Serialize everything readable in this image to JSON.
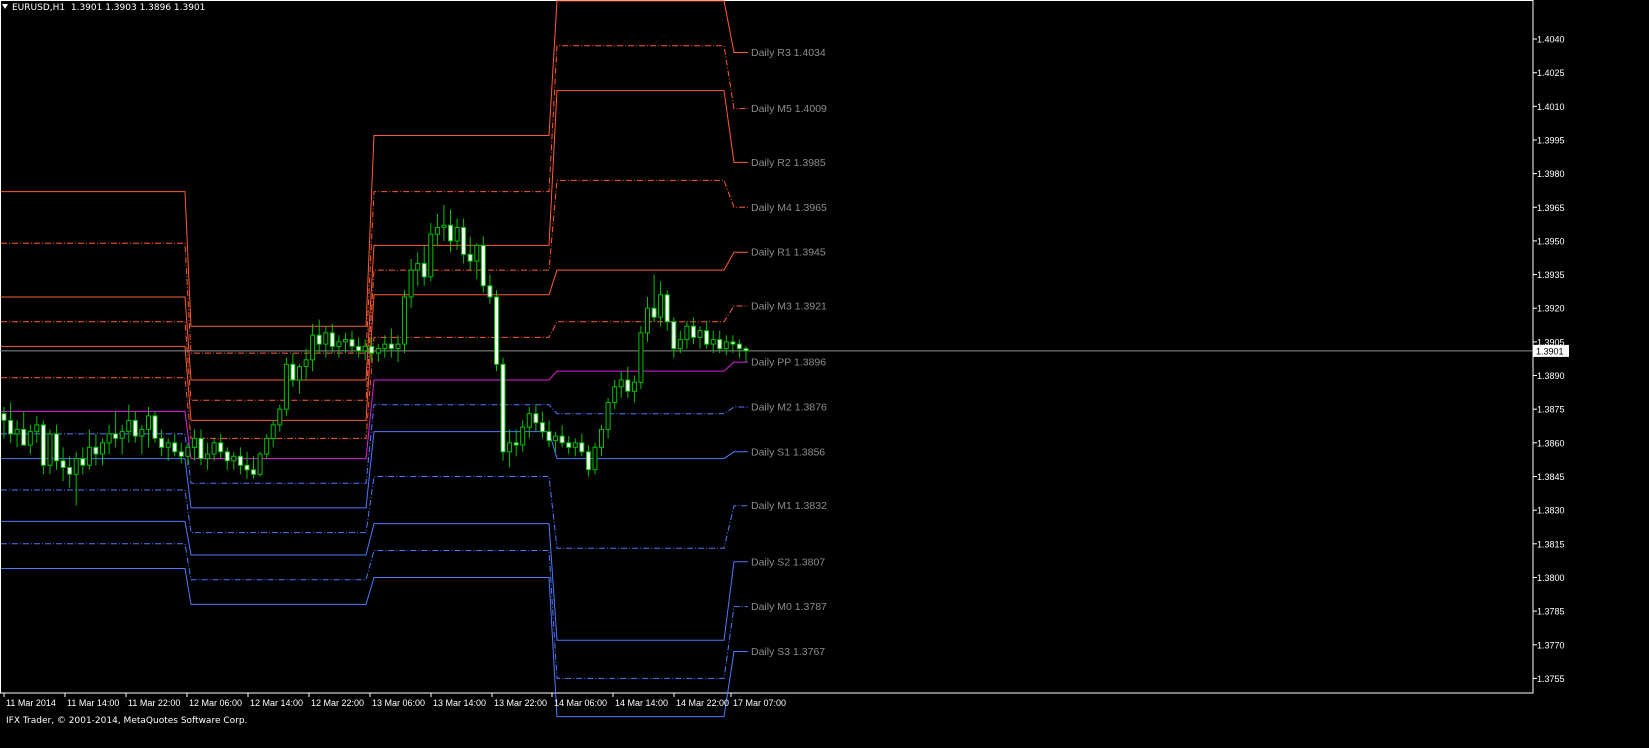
{
  "chart": {
    "symbol_title": "EURUSD,H1",
    "ohlc": "1.3901 1.3903 1.3896 1.3901",
    "current_price": "1.3901",
    "copyright": "IFX Trader, © 2001-2014, MetaQuotes Software Corp.",
    "colors": {
      "background": "#000000",
      "border": "#ffffff",
      "resistance": "#ff5a32",
      "pivot": "#e020e0",
      "support": "#4f79ff",
      "bull_candle": "#00c000",
      "bear_candle": "#ffffff",
      "label_text": "#8c8c8c"
    }
  },
  "chart_data": {
    "type": "candlestick",
    "price_axis": {
      "ylim": [
        1.37485,
        1.40565
      ],
      "ticks": [
        "1.4040",
        "1.4025",
        "1.4010",
        "1.3995",
        "1.3980",
        "1.3965",
        "1.3950",
        "1.3935",
        "1.3920",
        "1.3905",
        "1.3890",
        "1.3875",
        "1.3860",
        "1.3845",
        "1.3830",
        "1.3815",
        "1.3800",
        "1.3785",
        "1.3770",
        "1.3755"
      ]
    },
    "time_axis": {
      "labels": [
        "11 Mar 2014",
        "11 Mar 14:00",
        "11 Mar 22:00",
        "12 Mar 06:00",
        "12 Mar 14:00",
        "12 Mar 22:00",
        "13 Mar 06:00",
        "13 Mar 14:00",
        "13 Mar 22:00",
        "14 Mar 06:00",
        "14 Mar 14:00",
        "14 Mar 22:00",
        "17 Mar 07:00"
      ]
    },
    "pivot_labels": [
      {
        "name": "R3",
        "text": "Daily R3 1.4034",
        "value": 1.4034,
        "kind": "resistance",
        "style": "solid"
      },
      {
        "name": "M5",
        "text": "Daily M5 1.4009",
        "value": 1.4009,
        "kind": "resistance",
        "style": "dash"
      },
      {
        "name": "R2",
        "text": "Daily R2 1.3985",
        "value": 1.3985,
        "kind": "resistance",
        "style": "solid"
      },
      {
        "name": "M4",
        "text": "Daily M4 1.3965",
        "value": 1.3965,
        "kind": "resistance",
        "style": "dash"
      },
      {
        "name": "R1",
        "text": "Daily R1 1.3945",
        "value": 1.3945,
        "kind": "resistance",
        "style": "solid"
      },
      {
        "name": "M3",
        "text": "Daily M3 1.3921",
        "value": 1.3921,
        "kind": "resistance",
        "style": "dash"
      },
      {
        "name": "PP",
        "text": "Daily PP 1.3896",
        "value": 1.3896,
        "kind": "pivot",
        "style": "solid"
      },
      {
        "name": "M2",
        "text": "Daily M2 1.3876",
        "value": 1.3876,
        "kind": "support",
        "style": "dash"
      },
      {
        "name": "S1",
        "text": "Daily S1 1.3856",
        "value": 1.3856,
        "kind": "support",
        "style": "solid"
      },
      {
        "name": "M1",
        "text": "Daily M1 1.3832",
        "value": 1.3832,
        "kind": "support",
        "style": "dash"
      },
      {
        "name": "S2",
        "text": "Daily S2 1.3807",
        "value": 1.3807,
        "kind": "support",
        "style": "solid"
      },
      {
        "name": "M0",
        "text": "Daily M0 1.3787",
        "value": 1.3787,
        "kind": "support",
        "style": "dash"
      },
      {
        "name": "S3",
        "text": "Daily S3 1.3767",
        "value": 1.3767,
        "kind": "support",
        "style": "solid"
      }
    ],
    "daily_levels": [
      {
        "day": "11 Mar",
        "R3": 1.3972,
        "M5": 1.3949,
        "R2": 1.3925,
        "M4": 1.3914,
        "R1": 1.3903,
        "M3": 1.3889,
        "PP": 1.3874,
        "M2": 1.3864,
        "S1": 1.3853,
        "M1": 1.3839,
        "S2": 1.3825,
        "M0": 1.3815,
        "S3": 1.3804
      },
      {
        "day": "12 Mar",
        "R3": 1.3912,
        "M5": 1.39,
        "R2": 1.3888,
        "M4": 1.3879,
        "R1": 1.387,
        "M3": 1.3862,
        "PP": 1.3853,
        "M2": 1.3842,
        "S1": 1.3831,
        "M1": 1.382,
        "S2": 1.381,
        "M0": 1.3799,
        "S3": 1.3788
      },
      {
        "day": "13 Mar",
        "R3": 1.3997,
        "M5": 1.3972,
        "R2": 1.3948,
        "M4": 1.3937,
        "R1": 1.3926,
        "M3": 1.3907,
        "PP": 1.3888,
        "M2": 1.3877,
        "S1": 1.3865,
        "M1": 1.3845,
        "S2": 1.3824,
        "M0": 1.3812,
        "S3": 1.38
      },
      {
        "day": "14 Mar",
        "R3": 1.4057,
        "M5": 1.4037,
        "R2": 1.4017,
        "M4": 1.3977,
        "R1": 1.3937,
        "M3": 1.3914,
        "PP": 1.3892,
        "M2": 1.3873,
        "S1": 1.3853,
        "M1": 1.3813,
        "S2": 1.3772,
        "M0": 1.3755,
        "S3": 1.3738
      },
      {
        "day": "17 Mar",
        "R3": 1.4034,
        "M5": 1.4009,
        "R2": 1.3985,
        "M4": 1.3965,
        "R1": 1.3945,
        "M3": 1.3921,
        "PP": 1.3896,
        "M2": 1.3876,
        "S1": 1.3856,
        "M1": 1.3832,
        "S2": 1.3807,
        "M0": 1.3787,
        "S3": 1.3767
      }
    ],
    "candles": [
      [
        1.3873,
        1.3876,
        1.3862,
        1.387
      ],
      [
        1.387,
        1.3878,
        1.386,
        1.3864
      ],
      [
        1.3864,
        1.387,
        1.3858,
        1.3866
      ],
      [
        1.3866,
        1.3874,
        1.3862,
        1.3859
      ],
      [
        1.3859,
        1.3868,
        1.3855,
        1.3865
      ],
      [
        1.3865,
        1.3872,
        1.386,
        1.3868
      ],
      [
        1.3868,
        1.387,
        1.3846,
        1.385
      ],
      [
        1.385,
        1.3866,
        1.3846,
        1.3864
      ],
      [
        1.3864,
        1.3868,
        1.3848,
        1.3852
      ],
      [
        1.3852,
        1.3858,
        1.3843,
        1.3849
      ],
      [
        1.3849,
        1.3854,
        1.384,
        1.3846
      ],
      [
        1.3846,
        1.3856,
        1.3832,
        1.3853
      ],
      [
        1.3853,
        1.3858,
        1.3846,
        1.385
      ],
      [
        1.385,
        1.3866,
        1.3848,
        1.3858
      ],
      [
        1.3858,
        1.3864,
        1.385,
        1.3855
      ],
      [
        1.3855,
        1.3862,
        1.385,
        1.386
      ],
      [
        1.386,
        1.3868,
        1.3855,
        1.3864
      ],
      [
        1.3864,
        1.3874,
        1.3858,
        1.3862
      ],
      [
        1.3862,
        1.3868,
        1.3855,
        1.3865
      ],
      [
        1.3865,
        1.3877,
        1.386,
        1.387
      ],
      [
        1.387,
        1.3874,
        1.386,
        1.3863
      ],
      [
        1.3863,
        1.3868,
        1.3855,
        1.3866
      ],
      [
        1.3866,
        1.3876,
        1.3858,
        1.3872
      ],
      [
        1.3872,
        1.3874,
        1.386,
        1.3862
      ],
      [
        1.3862,
        1.3866,
        1.3854,
        1.3858
      ],
      [
        1.3858,
        1.3862,
        1.3852,
        1.386
      ],
      [
        1.386,
        1.3864,
        1.3854,
        1.3856
      ],
      [
        1.3856,
        1.386,
        1.3851,
        1.3854
      ],
      [
        1.3854,
        1.386,
        1.385,
        1.3858
      ],
      [
        1.3858,
        1.3866,
        1.3852,
        1.3862
      ],
      [
        1.3862,
        1.3866,
        1.385,
        1.3853
      ],
      [
        1.3853,
        1.386,
        1.3848,
        1.3855
      ],
      [
        1.3855,
        1.3862,
        1.3852,
        1.386
      ],
      [
        1.386,
        1.3864,
        1.3853,
        1.3856
      ],
      [
        1.3856,
        1.3858,
        1.3848,
        1.3852
      ],
      [
        1.3852,
        1.3856,
        1.3848,
        1.3854
      ],
      [
        1.3854,
        1.3858,
        1.3846,
        1.385
      ],
      [
        1.385,
        1.3856,
        1.3844,
        1.3848
      ],
      [
        1.3848,
        1.3854,
        1.3844,
        1.3846
      ],
      [
        1.3846,
        1.3856,
        1.3845,
        1.3855
      ],
      [
        1.3855,
        1.3864,
        1.3853,
        1.3862
      ],
      [
        1.3862,
        1.387,
        1.3858,
        1.3868
      ],
      [
        1.3868,
        1.3877,
        1.3865,
        1.3875
      ],
      [
        1.3875,
        1.3898,
        1.3872,
        1.3895
      ],
      [
        1.3895,
        1.39,
        1.3885,
        1.3888
      ],
      [
        1.3888,
        1.3895,
        1.3882,
        1.3894
      ],
      [
        1.3894,
        1.3902,
        1.3888,
        1.3897
      ],
      [
        1.3897,
        1.3913,
        1.3892,
        1.3908
      ],
      [
        1.3908,
        1.3915,
        1.39,
        1.3904
      ],
      [
        1.3904,
        1.3912,
        1.3898,
        1.3909
      ],
      [
        1.3909,
        1.3913,
        1.39,
        1.3903
      ],
      [
        1.3903,
        1.3908,
        1.3898,
        1.3905
      ],
      [
        1.3905,
        1.3909,
        1.39,
        1.3906
      ],
      [
        1.3906,
        1.391,
        1.39,
        1.3903
      ],
      [
        1.3903,
        1.3907,
        1.3898,
        1.3901
      ],
      [
        1.3901,
        1.3906,
        1.3897,
        1.3903
      ],
      [
        1.3903,
        1.3907,
        1.3896,
        1.39
      ],
      [
        1.39,
        1.3904,
        1.3896,
        1.3902
      ],
      [
        1.3902,
        1.3908,
        1.3898,
        1.3904
      ],
      [
        1.3904,
        1.3911,
        1.3898,
        1.3902
      ],
      [
        1.3902,
        1.3908,
        1.3896,
        1.3904
      ],
      [
        1.3904,
        1.3928,
        1.39,
        1.3925
      ],
      [
        1.3925,
        1.3942,
        1.392,
        1.3937
      ],
      [
        1.3937,
        1.3945,
        1.393,
        1.394
      ],
      [
        1.394,
        1.3948,
        1.393,
        1.3934
      ],
      [
        1.3934,
        1.3958,
        1.3932,
        1.3953
      ],
      [
        1.3953,
        1.3962,
        1.3948,
        1.3956
      ],
      [
        1.3956,
        1.3966,
        1.395,
        1.3957
      ],
      [
        1.3957,
        1.3964,
        1.3945,
        1.395
      ],
      [
        1.395,
        1.396,
        1.3946,
        1.3956
      ],
      [
        1.3956,
        1.396,
        1.394,
        1.3944
      ],
      [
        1.3944,
        1.3952,
        1.3937,
        1.3941
      ],
      [
        1.3941,
        1.3949,
        1.3933,
        1.3948
      ],
      [
        1.3948,
        1.3952,
        1.3927,
        1.393
      ],
      [
        1.393,
        1.3935,
        1.3922,
        1.3925
      ],
      [
        1.3925,
        1.3928,
        1.3892,
        1.3895
      ],
      [
        1.3895,
        1.3898,
        1.3852,
        1.3856
      ],
      [
        1.3856,
        1.3866,
        1.3849,
        1.386
      ],
      [
        1.386,
        1.3866,
        1.3854,
        1.3859
      ],
      [
        1.3859,
        1.387,
        1.3856,
        1.3867
      ],
      [
        1.3867,
        1.3876,
        1.3862,
        1.3873
      ],
      [
        1.3873,
        1.3877,
        1.3865,
        1.3869
      ],
      [
        1.3869,
        1.3874,
        1.3862,
        1.3865
      ],
      [
        1.3865,
        1.387,
        1.3858,
        1.3861
      ],
      [
        1.3861,
        1.3865,
        1.3856,
        1.3863
      ],
      [
        1.3863,
        1.3868,
        1.3858,
        1.386
      ],
      [
        1.386,
        1.3863,
        1.3855,
        1.3858
      ],
      [
        1.3858,
        1.3862,
        1.3854,
        1.386
      ],
      [
        1.386,
        1.3864,
        1.3854,
        1.3856
      ],
      [
        1.3856,
        1.3859,
        1.3845,
        1.3848
      ],
      [
        1.3848,
        1.386,
        1.3846,
        1.3858
      ],
      [
        1.3858,
        1.3868,
        1.3854,
        1.3866
      ],
      [
        1.3866,
        1.388,
        1.3862,
        1.3878
      ],
      [
        1.3878,
        1.3888,
        1.3875,
        1.3885
      ],
      [
        1.3885,
        1.3892,
        1.388,
        1.3888
      ],
      [
        1.3888,
        1.3894,
        1.388,
        1.3883
      ],
      [
        1.3883,
        1.389,
        1.3878,
        1.3887
      ],
      [
        1.3887,
        1.3912,
        1.3884,
        1.3909
      ],
      [
        1.3909,
        1.3925,
        1.3905,
        1.392
      ],
      [
        1.392,
        1.3935,
        1.3914,
        1.3916
      ],
      [
        1.3916,
        1.3932,
        1.3912,
        1.3926
      ],
      [
        1.3926,
        1.3928,
        1.391,
        1.3914
      ],
      [
        1.3914,
        1.3916,
        1.3898,
        1.3902
      ],
      [
        1.3902,
        1.391,
        1.39,
        1.3906
      ],
      [
        1.3906,
        1.3914,
        1.3902,
        1.3912
      ],
      [
        1.3912,
        1.3916,
        1.3904,
        1.3907
      ],
      [
        1.3907,
        1.3912,
        1.3902,
        1.391
      ],
      [
        1.391,
        1.3914,
        1.3902,
        1.3904
      ],
      [
        1.3904,
        1.391,
        1.39,
        1.3906
      ],
      [
        1.3906,
        1.391,
        1.39,
        1.3902
      ],
      [
        1.3902,
        1.3908,
        1.3899,
        1.3905
      ],
      [
        1.3905,
        1.3908,
        1.39,
        1.3904
      ],
      [
        1.3904,
        1.3906,
        1.3898,
        1.3902
      ],
      [
        1.3902,
        1.3903,
        1.3896,
        1.3901
      ]
    ]
  }
}
